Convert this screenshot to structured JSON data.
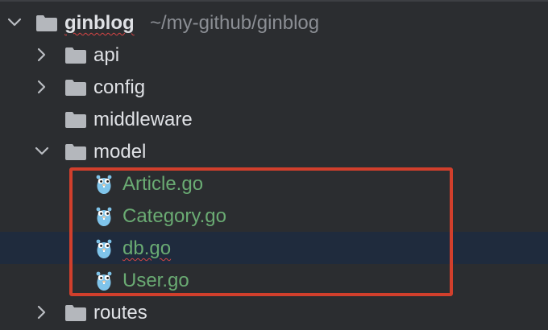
{
  "project": {
    "root_name": "ginblog",
    "root_path": "~/my-github/ginblog",
    "root_expanded": true
  },
  "tree": {
    "folders": [
      {
        "name": "api",
        "expanded": false
      },
      {
        "name": "config",
        "expanded": false
      },
      {
        "name": "middleware",
        "expanded": null
      },
      {
        "name": "model",
        "expanded": true
      },
      {
        "name": "routes",
        "expanded": false
      }
    ],
    "model_files": [
      {
        "name": "Article.go",
        "icon": "go-gopher-icon"
      },
      {
        "name": "Category.go",
        "icon": "go-gopher-icon"
      },
      {
        "name": "db.go",
        "icon": "go-gopher-icon",
        "selected": true
      },
      {
        "name": "User.go",
        "icon": "go-gopher-icon"
      }
    ]
  },
  "colors": {
    "background": "#2b2d30",
    "selected_row": "#1f2b3d",
    "text": "#dfe1e5",
    "go_file_text": "#6aab73",
    "path_hint": "#8b8e94",
    "highlight_box": "#d13f2c",
    "gopher": "#7fc4ea"
  }
}
